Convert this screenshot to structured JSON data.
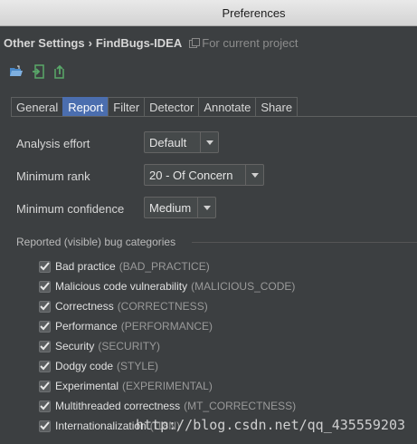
{
  "window": {
    "title": "Preferences"
  },
  "breadcrumb": {
    "section": "Other Settings",
    "separator": "›",
    "page": "FindBugs-IDEA",
    "scope": "For current project"
  },
  "toolbar": {
    "icons": [
      "open-folder-icon",
      "import-icon",
      "export-icon"
    ]
  },
  "tabs": [
    {
      "label": "General",
      "active": false
    },
    {
      "label": "Report",
      "active": true
    },
    {
      "label": "Filter",
      "active": false
    },
    {
      "label": "Detector",
      "active": false
    },
    {
      "label": "Annotate",
      "active": false
    },
    {
      "label": "Share",
      "active": false
    }
  ],
  "settings": {
    "analysis_effort": {
      "label": "Analysis effort",
      "value": "Default"
    },
    "minimum_rank": {
      "label": "Minimum rank",
      "value": "20 - Of Concern"
    },
    "minimum_confidence": {
      "label": "Minimum confidence",
      "value": "Medium"
    }
  },
  "categories": {
    "title": "Reported (visible) bug categories",
    "items": [
      {
        "name": "Bad practice",
        "code": "(BAD_PRACTICE)",
        "checked": true
      },
      {
        "name": "Malicious code vulnerability",
        "code": "(MALICIOUS_CODE)",
        "checked": true
      },
      {
        "name": "Correctness",
        "code": "(CORRECTNESS)",
        "checked": true
      },
      {
        "name": "Performance",
        "code": "(PERFORMANCE)",
        "checked": true
      },
      {
        "name": "Security",
        "code": "(SECURITY)",
        "checked": true
      },
      {
        "name": "Dodgy code",
        "code": "(STYLE)",
        "checked": true
      },
      {
        "name": "Experimental",
        "code": "(EXPERIMENTAL)",
        "checked": true
      },
      {
        "name": "Multithreaded correctness",
        "code": "(MT_CORRECTNESS)",
        "checked": true
      },
      {
        "name": "Internationalization",
        "code": "(I18N)",
        "checked": true
      }
    ]
  },
  "watermark": "http://blog.csdn.net/qq_435559203",
  "colors": {
    "background": "#3c3f41",
    "active_tab": "#4b6eaf",
    "checkmark": "#e8e8e8"
  }
}
